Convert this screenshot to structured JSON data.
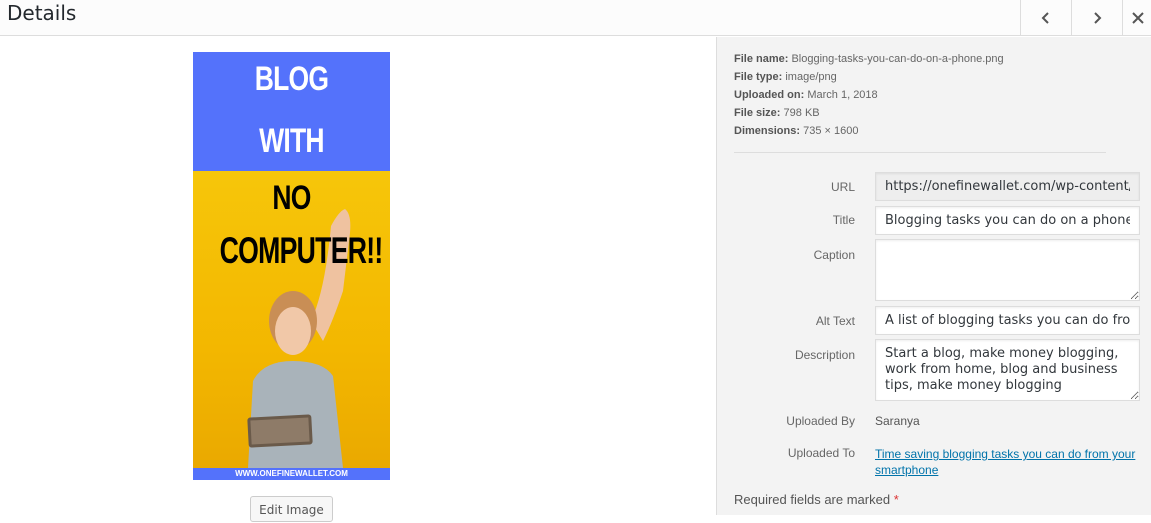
{
  "header": {
    "title": "Details",
    "prev_icon": "chevron-left-icon",
    "next_icon": "chevron-right-icon",
    "close_icon": "close-icon"
  },
  "preview": {
    "image_lines": [
      "BLOG",
      "WITH",
      "NO",
      "COMPUTER!!"
    ],
    "image_footer": "WWW.ONEFINEWALLET.COM",
    "edit_button": "Edit Image",
    "colors": {
      "blue": "#5472fb",
      "yellow": "#f5c000"
    }
  },
  "file_info": {
    "file_name_label": "File name:",
    "file_name": "Blogging-tasks-you-can-do-on-a-phone.png",
    "file_type_label": "File type:",
    "file_type": "image/png",
    "uploaded_on_label": "Uploaded on:",
    "uploaded_on": "March 1, 2018",
    "file_size_label": "File size:",
    "file_size": "798 KB",
    "dimensions_label": "Dimensions:",
    "dimensions": "735 × 1600"
  },
  "form": {
    "url_label": "URL",
    "url_value": "https://onefinewallet.com/wp-content/u",
    "title_label": "Title",
    "title_value": "Blogging tasks you can do on a phone",
    "caption_label": "Caption",
    "caption_value": "",
    "alt_label": "Alt Text",
    "alt_value": "A list of blogging tasks you can do from",
    "description_label": "Description",
    "description_value": "Start a blog, make money blogging, work from home, blog and business tips, make money blogging",
    "uploaded_by_label": "Uploaded By",
    "uploaded_by": "Saranya",
    "uploaded_to_label": "Uploaded To",
    "uploaded_to": "Time saving blogging tasks you can do from your smartphone",
    "required_text": "Required fields are marked",
    "required_star": "*"
  }
}
